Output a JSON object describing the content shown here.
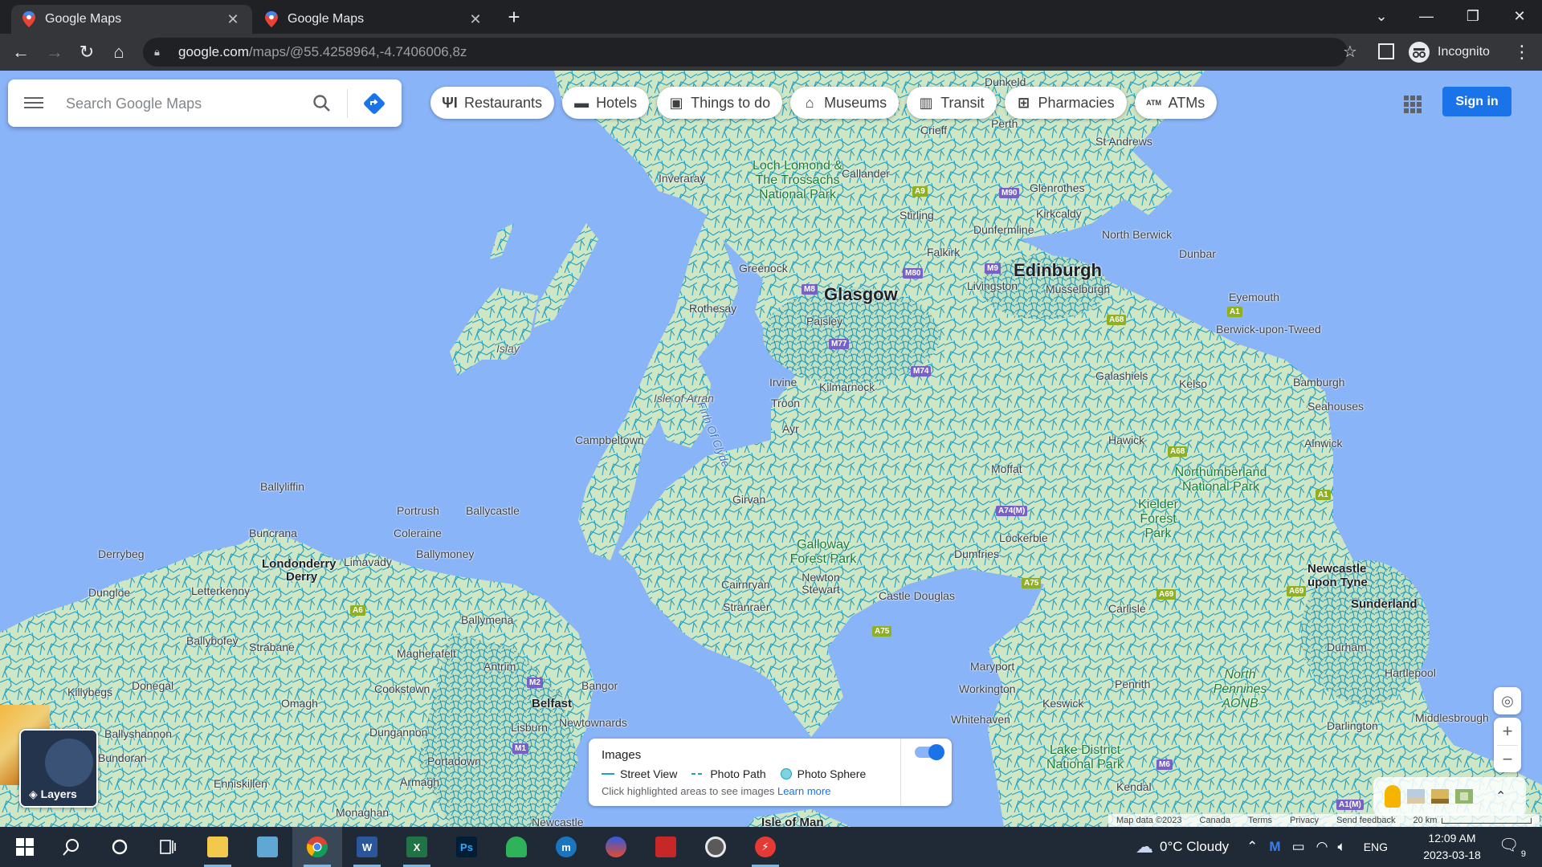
{
  "browser": {
    "tabs": [
      {
        "title": "Google Maps",
        "active": true
      },
      {
        "title": "Google Maps",
        "active": false
      }
    ],
    "url_domain": "google.com",
    "url_path": "/maps/@55.4258964,-4.7406006,8z",
    "profile_label": "Incognito"
  },
  "search": {
    "placeholder": "Search Google Maps"
  },
  "chips": [
    {
      "label": "Restaurants",
      "icon": "fork-knife-icon"
    },
    {
      "label": "Hotels",
      "icon": "bed-icon"
    },
    {
      "label": "Things to do",
      "icon": "camera-icon"
    },
    {
      "label": "Museums",
      "icon": "museum-icon"
    },
    {
      "label": "Transit",
      "icon": "train-icon"
    },
    {
      "label": "Pharmacies",
      "icon": "pharmacy-icon"
    },
    {
      "label": "ATMs",
      "icon": "atm-icon"
    }
  ],
  "header": {
    "sign_in": "Sign in"
  },
  "map_labels": {
    "glasgow": "Glasgow",
    "edinburgh": "Edinburgh",
    "belfast": "Belfast",
    "londonderry": "Londonderry",
    "derry": "Derry",
    "newcastle": "Newcastle upon Tyne",
    "sunderland": "Sunderland",
    "isle_of_arran": "Isle of Arran",
    "islay": "Islay",
    "firth_of_clyde": "Firth Of Clyde",
    "perth": "Perth",
    "st_andrews": "St Andrews",
    "crieff": "Crieff",
    "dunkeld": "Dunkeld",
    "inveraray": "Inveraray",
    "callander": "Callander",
    "stirling": "Stirling",
    "glenrothes": "Glenrothes",
    "kirkcaldy": "Kirkcaldy",
    "dunfermline": "Dunfermline",
    "north_berwick": "North Berwick",
    "dunbar": "Dunbar",
    "falkirk": "Falkirk",
    "livingston": "Livingston",
    "musselburgh": "Musselburgh",
    "greenock": "Greenock",
    "paisley": "Paisley",
    "rothesay": "Rothesay",
    "eyemouth": "Eyemouth",
    "berwick": "Berwick-upon-Tweed",
    "irvine": "Irvine",
    "kilmarnock": "Kilmarnock",
    "troon": "Troon",
    "ayr": "Ayr",
    "galashiels": "Galashiels",
    "kelso": "Kelso",
    "bamburgh": "Bamburgh",
    "seahouses": "Seahouses",
    "campbeltown": "Campbeltown",
    "hawick": "Hawick",
    "alnwick": "Alnwick",
    "moffat": "Moffat",
    "girvan": "Girvan",
    "lockerbie": "Lockerbie",
    "dumfries": "Dumfries",
    "newton_stewart": "Newton Stewart",
    "castle_douglas": "Castle Douglas",
    "cairnryan": "Cairnryan",
    "stranraer": "Stranraer",
    "carlisle": "Carlisle",
    "durham": "Durham",
    "hartlepool": "Hartlepool",
    "middlesbrough": "Middlesbrough",
    "darlington": "Darlington",
    "maryport": "Maryport",
    "workington": "Workington",
    "penrith": "Penrith",
    "keswick": "Keswick",
    "whitehaven": "Whitehaven",
    "kendal": "Kendal",
    "ballyliffin": "Ballyliffin",
    "portrush": "Portrush",
    "ballycastle": "Ballycastle",
    "buncrana": "Buncrana",
    "coleraine": "Coleraine",
    "derrybeg": "Derrybeg",
    "limavady": "Limavady",
    "ballymoney": "Ballymoney",
    "dungloe": "Dungloe",
    "letterkenny": "Letterkenny",
    "ballymena": "Ballymena",
    "ballybofey": "Ballybofey",
    "strabane": "Strabane",
    "magherafelt": "Magherafelt",
    "antrim": "Antrim",
    "killybegs": "Killybegs",
    "donegal": "Donegal",
    "omagh": "Omagh",
    "cookstown": "Cookstown",
    "bangor": "Bangor",
    "ballyshannon": "Ballyshannon",
    "dungannon": "Dungannon",
    "newtownards": "Newtownards",
    "lisburn": "Lisburn",
    "bundoran": "Bundoran",
    "portadown": "Portadown",
    "enniskillen": "Enniskillen",
    "armagh": "Armagh",
    "monaghan": "Monaghan",
    "newcastle_ni": "Newcastle",
    "isle_of_man": "Isle of Man",
    "loch_lomond": "Loch Lomond & The Trossachs National Park",
    "galloway": "Galloway Forest Park",
    "kielder": "Kielder Forest Park",
    "northumberland": "Northumberland National Park",
    "north_pennines": "North Pennines AONB",
    "lake_district": "Lake District National Park"
  },
  "shields": {
    "a9": "A9",
    "m90": "M90",
    "m80": "M80",
    "m9": "M9",
    "m8": "M8",
    "m77": "M77",
    "m74": "M74",
    "a68": "A68",
    "a1": "A1",
    "a68b": "A68",
    "a1b": "A1",
    "a74m": "A74(M)",
    "a75": "A75",
    "a75b": "A75",
    "a69": "A69",
    "a69b": "A69",
    "m6": "M6",
    "a1m": "A1(M)",
    "a6": "A6",
    "m2": "M2",
    "m1": "M1"
  },
  "images_panel": {
    "title": "Images",
    "street_view": "Street View",
    "photo_path": "Photo Path",
    "photo_sphere": "Photo Sphere",
    "hint": "Click highlighted areas to see images",
    "learn_more": "Learn more",
    "enabled": true
  },
  "layers": {
    "label": "Layers"
  },
  "footer": {
    "map_data": "Map data ©2023",
    "region": "Canada",
    "terms": "Terms",
    "privacy": "Privacy",
    "feedback": "Send feedback",
    "scale": "20 km"
  },
  "taskbar": {
    "weather": "0°C  Cloudy",
    "language": "ENG",
    "time": "12:09 AM",
    "date": "2023-03-18",
    "notifications": "9"
  },
  "colors": {
    "water": "#8ab4f8",
    "land": "#cfe6c4",
    "roads_highlight": "#1da1c9",
    "accent": "#1a73e8"
  }
}
